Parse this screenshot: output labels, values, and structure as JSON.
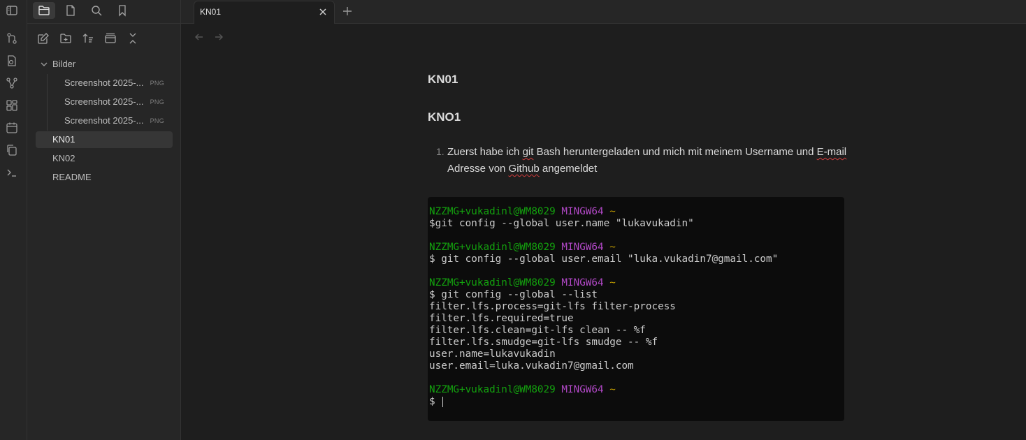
{
  "tab": {
    "title": "KN01"
  },
  "sidebar": {
    "tree": {
      "folder": "Bilder",
      "images": [
        {
          "name": "Screenshot 2025-...",
          "ext": "PNG"
        },
        {
          "name": "Screenshot 2025-...",
          "ext": "PNG"
        },
        {
          "name": "Screenshot 2025-...",
          "ext": "PNG"
        }
      ],
      "notes": [
        {
          "name": "KN01"
        },
        {
          "name": "KN02"
        },
        {
          "name": "README"
        }
      ]
    }
  },
  "note": {
    "inline_title": "KN01",
    "heading": "KNO1",
    "list_number": "1.",
    "list_text_1": "Zuerst habe ich ",
    "list_git": "git",
    "list_text_2": " Bash heruntergeladen und mich mit meinem Username und ",
    "list_email": "E-mail",
    "list_text_3": " Adresse von ",
    "list_github": "Github",
    "list_text_4": " angemeldet"
  },
  "terminal": {
    "prompt_user": "NZZMG+vukadinl@WM8029",
    "prompt_env": "MINGW64",
    "prompt_path": "~",
    "cmd1": "$git config --global user.name \"lukavukadin\"",
    "cmd2": "$ git config --global user.email \"luka.vukadin7@gmail.com\"",
    "cmd3": "$ git config --global --list",
    "out": [
      "filter.lfs.process=git-lfs filter-process",
      "filter.lfs.required=true",
      "filter.lfs.clean=git-lfs clean -- %f",
      "filter.lfs.smudge=git-lfs smudge -- %f",
      "user.name=lukavukadin",
      "user.email=luka.vukadin7@gmail.com"
    ],
    "final_prompt": "$ "
  },
  "icons": {
    "ribbon": [
      "sidebar-toggle-icon",
      "git-icon",
      "file-recovery-icon",
      "graph-icon",
      "canvas-icon",
      "calendar-icon",
      "copy-icon",
      "terminal-icon"
    ],
    "sidebar_tabs": [
      "files-icon",
      "file-icon",
      "search-icon",
      "bookmark-icon"
    ],
    "sidebar_nav": [
      "new-note-icon",
      "new-folder-icon",
      "sort-icon",
      "collapse-view-icon",
      "collapse-all-icon"
    ]
  }
}
